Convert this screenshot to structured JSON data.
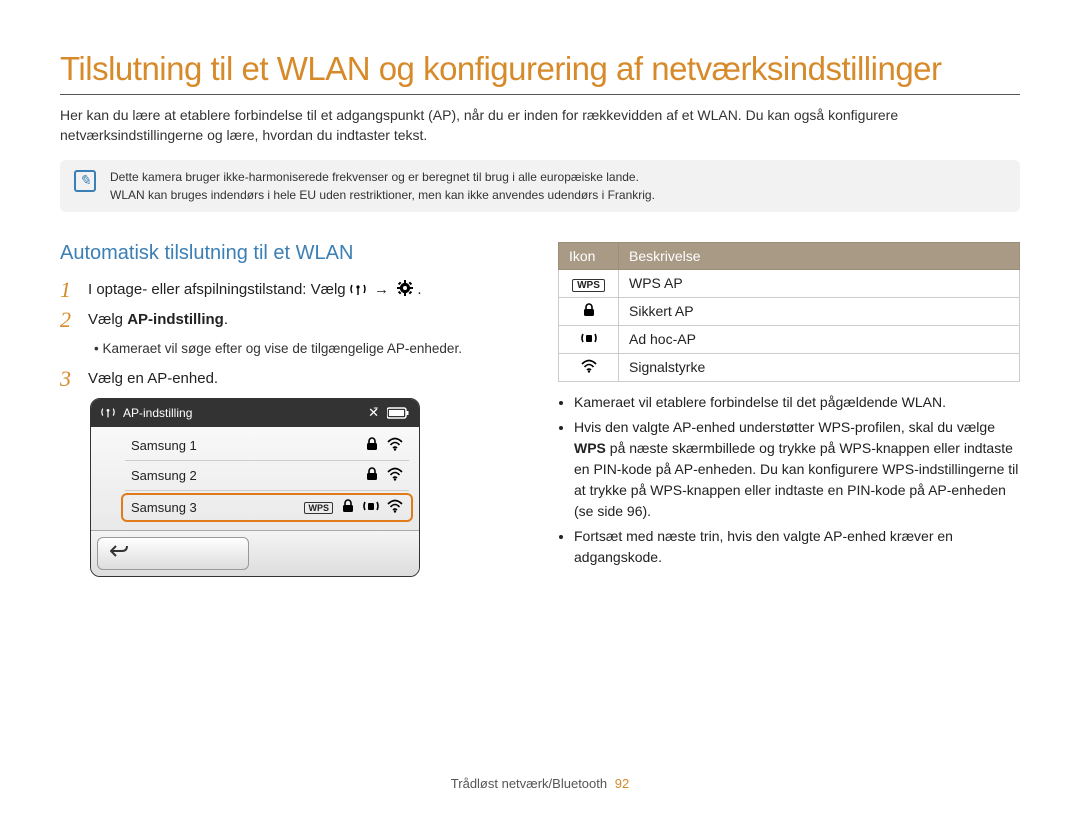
{
  "title": "Tilslutning til et WLAN og konfigurering af netværksindstillinger",
  "intro": "Her kan du lære at etablere forbindelse til et adgangspunkt (AP), når du er inden for rækkevidden af et WLAN. Du kan også konfigurere netværksindstillingerne og lære, hvordan du indtaster tekst.",
  "note": {
    "line1": "Dette kamera bruger ikke-harmoniserede frekvenser og er beregnet til brug i alle europæiske lande.",
    "line2": "WLAN kan bruges indendørs i hele EU uden restriktioner, men kan ikke anvendes udendørs i Frankrig."
  },
  "section_title": "Automatisk tilslutning til et WLAN",
  "steps": {
    "s1_pre": "I optage- eller afspilningstilstand: Vælg ",
    "s1_arrow": "→",
    "s1_post": ".",
    "s2_pre": "Vælg ",
    "s2_bold": "AP-indstilling",
    "s2_post": ".",
    "s2_bullet": "Kameraet vil søge efter og vise de tilgængelige AP-enheder.",
    "s3": "Vælg en AP-enhed."
  },
  "device": {
    "header_label": "AP-indstilling",
    "rows": [
      {
        "name": "Samsung 1",
        "wps": false,
        "lock": true,
        "adhoc": false,
        "wifi": true,
        "selected": false
      },
      {
        "name": "Samsung 2",
        "wps": false,
        "lock": true,
        "adhoc": false,
        "wifi": true,
        "selected": false
      },
      {
        "name": "Samsung 3",
        "wps": true,
        "lock": true,
        "adhoc": true,
        "wifi": true,
        "selected": true
      }
    ]
  },
  "icon_table": {
    "head_icon": "Ikon",
    "head_desc": "Beskrivelse",
    "rows": [
      {
        "icon": "wps",
        "label": "WPS AP"
      },
      {
        "icon": "lock",
        "label": "Sikkert AP"
      },
      {
        "icon": "adhoc",
        "label": "Ad hoc-AP"
      },
      {
        "icon": "wifi",
        "label": "Signalstyrke"
      }
    ]
  },
  "right_bullets": {
    "b1": "Kameraet vil etablere forbindelse til det pågældende WLAN.",
    "b2_pre": "Hvis den valgte AP-enhed understøtter WPS-profilen, skal du vælge ",
    "b2_bold": "WPS",
    "b2_post": " på næste skærmbillede og trykke på WPS-knappen eller indtaste en PIN-kode på AP-enheden. Du kan konfigurere WPS-indstillingerne til at trykke på WPS-knappen eller indtaste en PIN-kode på AP-enheden (se side 96).",
    "b3": "Fortsæt med næste trin, hvis den valgte AP-enhed kræver en adgangskode."
  },
  "footer": {
    "section": "Trådløst netværk/Bluetooth",
    "page": "92"
  }
}
